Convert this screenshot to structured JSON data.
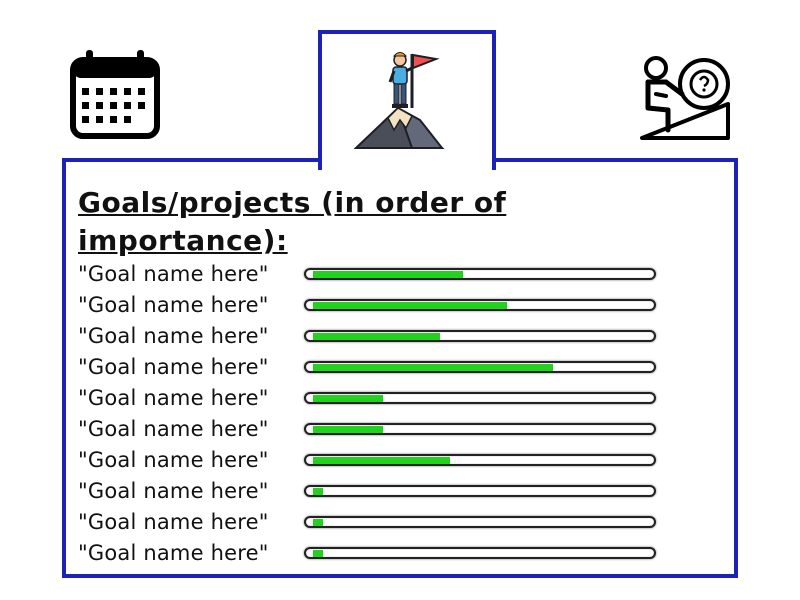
{
  "colors": {
    "frame": "#1c22b8",
    "progress_fill": "#22d21e",
    "text": "#111111"
  },
  "tabs": [
    {
      "icon": "calendar-icon",
      "active": false
    },
    {
      "icon": "mountain-summit-flag-icon",
      "active": true
    },
    {
      "icon": "climber-pushing-boulder-icon",
      "active": false
    }
  ],
  "panel": {
    "title": "Goals/projects (in order of importance):",
    "goals": [
      {
        "name": "\"Goal name here\"",
        "progress": 0.45
      },
      {
        "name": "\"Goal name here\"",
        "progress": 0.58
      },
      {
        "name": "\"Goal name here\"",
        "progress": 0.38
      },
      {
        "name": "\"Goal name here\"",
        "progress": 0.72
      },
      {
        "name": "\"Goal name here\"",
        "progress": 0.21
      },
      {
        "name": "\"Goal name here\"",
        "progress": 0.21
      },
      {
        "name": "\"Goal name here\"",
        "progress": 0.41
      },
      {
        "name": "\"Goal name here\"",
        "progress": 0.03
      },
      {
        "name": "\"Goal name here\"",
        "progress": 0.03
      },
      {
        "name": "\"Goal name here\"",
        "progress": 0.03
      }
    ]
  }
}
